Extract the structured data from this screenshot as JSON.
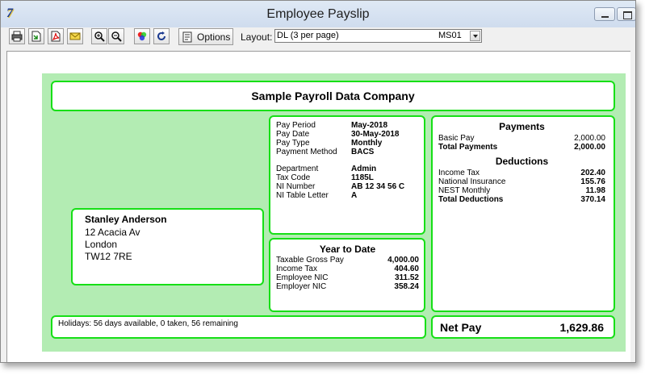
{
  "window": {
    "title": "Employee Payslip",
    "app_icon": "7"
  },
  "toolbar": {
    "buttons": [
      "print-icon",
      "export-icon",
      "pdf-icon",
      "email-icon",
      "zoom-in-icon",
      "zoom-out-icon",
      "color-icon",
      "refresh-icon"
    ],
    "options_label": "Options",
    "layout_label": "Layout:",
    "layout_value": "DL (3 per page)",
    "layout_code": "MS01"
  },
  "payslip": {
    "company": "Sample Payroll Data Company",
    "employee": {
      "name": "Stanley Anderson",
      "address": [
        "12 Acacia Av",
        "London",
        "TW12 7RE"
      ]
    },
    "details": [
      {
        "label": "Pay Period",
        "value": "May-2018"
      },
      {
        "label": "Pay Date",
        "value": "30-May-2018"
      },
      {
        "label": "Pay Type",
        "value": "Monthly"
      },
      {
        "label": "Payment Method",
        "value": "BACS"
      },
      {
        "label": "Department",
        "value": "Admin"
      },
      {
        "label": "Tax Code",
        "value": "1185L"
      },
      {
        "label": "NI Number",
        "value": "AB 12 34 56 C"
      },
      {
        "label": "NI Table Letter",
        "value": "A"
      }
    ],
    "ytd": {
      "title": "Year to Date",
      "rows": [
        {
          "label": "Taxable Gross Pay",
          "value": "4,000.00"
        },
        {
          "label": "Income Tax",
          "value": "404.60"
        },
        {
          "label": "Employee NIC",
          "value": "311.52"
        },
        {
          "label": "Employer NIC",
          "value": "358.24"
        }
      ]
    },
    "payments": {
      "title": "Payments",
      "rows": [
        {
          "label": "Basic Pay",
          "value": "2,000.00"
        }
      ],
      "total_label": "Total Payments",
      "total_value": "2,000.00"
    },
    "deductions": {
      "title": "Deductions",
      "rows": [
        {
          "label": "Income Tax",
          "value": "202.40"
        },
        {
          "label": "National Insurance",
          "value": "155.76"
        },
        {
          "label": "NEST Monthly",
          "value": "11.98"
        }
      ],
      "total_label": "Total Deductions",
      "total_value": "370.14"
    },
    "holidays": "Holidays: 56 days available, 0 taken, 56 remaining",
    "net_pay_label": "Net Pay",
    "net_pay_value": "1,629.86"
  },
  "colors": {
    "border": "#16df16",
    "background": "#b3ecb3"
  }
}
